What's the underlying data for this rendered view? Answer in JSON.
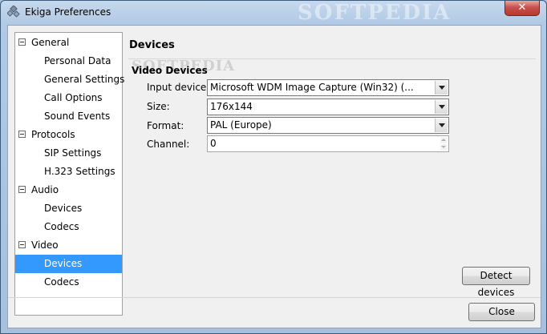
{
  "window": {
    "title": "Ekiga Preferences",
    "watermark": "SOFTPEDIA",
    "close_glyph": "✕"
  },
  "tree": {
    "items": [
      {
        "label": "General",
        "level": 0
      },
      {
        "label": "Personal Data",
        "level": 1
      },
      {
        "label": "General Settings",
        "level": 1
      },
      {
        "label": "Call Options",
        "level": 1
      },
      {
        "label": "Sound Events",
        "level": 1
      },
      {
        "label": "Protocols",
        "level": 0
      },
      {
        "label": "SIP Settings",
        "level": 1
      },
      {
        "label": "H.323 Settings",
        "level": 1
      },
      {
        "label": "Audio",
        "level": 0
      },
      {
        "label": "Devices",
        "level": 1
      },
      {
        "label": "Codecs",
        "level": 1
      },
      {
        "label": "Video",
        "level": 0
      },
      {
        "label": "Devices",
        "level": 1,
        "selected": true
      },
      {
        "label": "Codecs",
        "level": 1
      }
    ]
  },
  "main": {
    "title": "Devices",
    "watermark": "SOFTPEDIA",
    "section": "Video Devices",
    "fields": {
      "input_device": {
        "label": "Input device:",
        "value": "Microsoft WDM Image Capture (Win32) (..."
      },
      "size": {
        "label": "Size:",
        "value": "176x144"
      },
      "format": {
        "label": "Format:",
        "value": "PAL (Europe)"
      },
      "channel": {
        "label": "Channel:",
        "value": "0"
      }
    },
    "detect_button": "Detect devices"
  },
  "footer": {
    "close_button": "Close"
  },
  "colors": {
    "selection": "#3399ff",
    "titlebar": "#b0c9e4",
    "close_red": "#c75050"
  }
}
